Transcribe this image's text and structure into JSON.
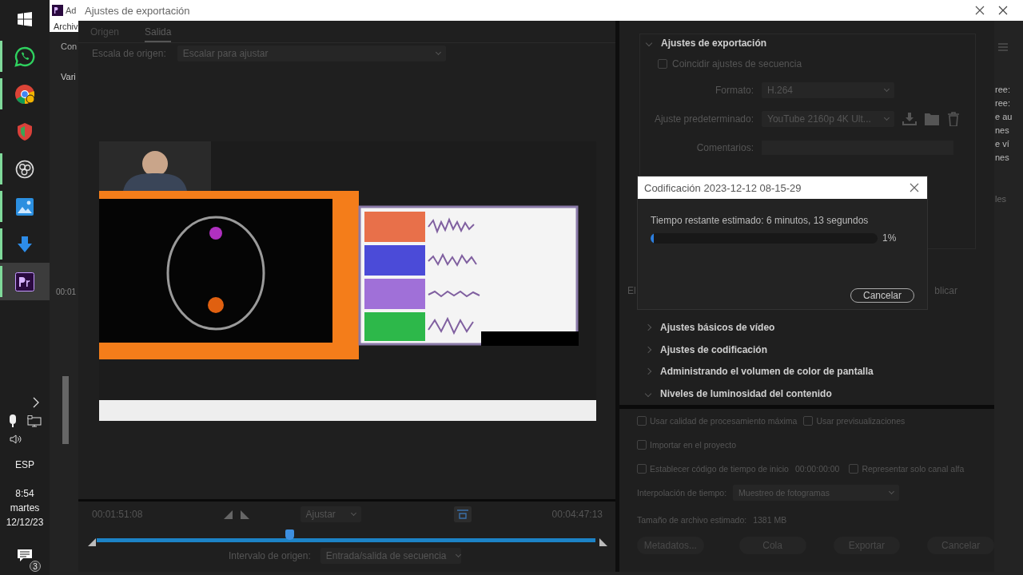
{
  "taskbar": {
    "apps": [
      {
        "kind": "windows",
        "running": false,
        "selected": false
      },
      {
        "kind": "whatsapp",
        "running": true,
        "selected": false
      },
      {
        "kind": "chrome",
        "running": true,
        "selected": false
      },
      {
        "kind": "shield",
        "running": false,
        "selected": false
      },
      {
        "kind": "obs",
        "running": true,
        "selected": false
      },
      {
        "kind": "photos",
        "running": true,
        "selected": false
      },
      {
        "kind": "download",
        "running": true,
        "selected": false
      },
      {
        "kind": "premiere",
        "running": true,
        "selected": true
      }
    ],
    "tray": {
      "language": "ESP",
      "time": "8:54",
      "day": "martes",
      "date": "12/12/23",
      "notifications": "3"
    }
  },
  "background_app": {
    "title": "Ad",
    "menu": "Archiv",
    "panel_tab": "Con",
    "panel_label": "Vari",
    "timecode": "00:01",
    "side_texts": [
      "ree:",
      "ree:",
      "e au",
      "nes",
      "e ví",
      "nes"
    ],
    "side_label": "les"
  },
  "export_dialog": {
    "title": "Ajustes de exportación",
    "tabs": [
      {
        "label": "Origen",
        "selected": false
      },
      {
        "label": "Salida",
        "selected": true
      }
    ],
    "source_scale": {
      "label": "Escala de origen:",
      "value": "Escalar para ajustar"
    },
    "preview": {
      "kind": "picture"
    },
    "timeline": {
      "current": "00:01:51:08",
      "duration": "00:04:47:13",
      "zoom": "Ajustar",
      "level": 0.387,
      "range_label": "Intervalo de origen:",
      "range_value": "Entrada/salida de secuencia"
    },
    "settings": {
      "section": {
        "title": "Ajustes de exportación",
        "expanded": true
      },
      "match_sequence": {
        "label": "Coincidir ajustes de secuencia",
        "checked": false
      },
      "format": {
        "label": "Formato:",
        "value": "H.264"
      },
      "preset": {
        "label": "Ajuste predeterminado:",
        "value": "YouTube 2160p 4K Ult..."
      },
      "comments": {
        "label": "Comentarios:"
      },
      "tabs": [
        "El",
        "blicar"
      ],
      "sections": [
        {
          "title": "Ajustes básicos de vídeo",
          "expanded": false
        },
        {
          "title": "Ajustes de codificación",
          "expanded": false
        },
        {
          "title": "Administrando el volumen de color de pantalla",
          "expanded": false
        },
        {
          "title": "Niveles de luminosidad del contenido",
          "expanded": true
        }
      ]
    },
    "option_rows": [
      [
        {
          "kind": "checkbox",
          "label": "Usar calidad de procesamiento máxima",
          "checked": false
        },
        {
          "kind": "checkbox",
          "label": "Usar previsualizaciones",
          "checked": false
        }
      ],
      [
        {
          "kind": "checkbox",
          "label": "Importar en el proyecto",
          "checked": false
        }
      ],
      [
        {
          "kind": "checkbox",
          "label": "Establecer código de tiempo de inicio",
          "checked": false
        },
        {
          "kind": "timecode",
          "label": "00:00:00:00"
        },
        {
          "kind": "checkbox",
          "label": "Representar solo canal alfa",
          "checked": false
        }
      ]
    ],
    "interpolation": {
      "label": "Interpolación de tiempo:",
      "value": "Muestreo de fotogramas"
    },
    "file_size": {
      "label": "Tamaño de archivo estimado:",
      "value": "1381 MB"
    },
    "buttons": [
      "Metadatos...",
      "Cola",
      "Exportar",
      "Cancelar"
    ]
  },
  "encoding_dialog": {
    "title": "Codificación 2023-12-12 08-15-29",
    "status": "Tiempo restante estimado: 6 minutos, 13 segundos",
    "level": 0.01,
    "percent": "1%",
    "button": "Cancelar"
  }
}
